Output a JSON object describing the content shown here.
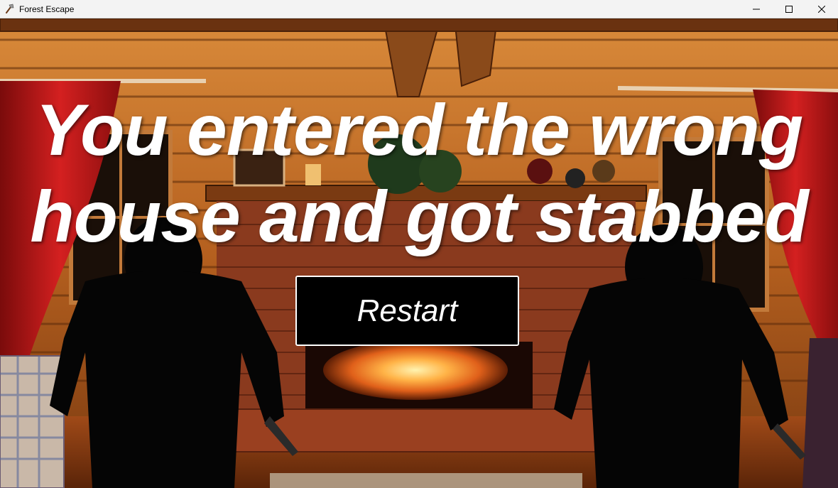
{
  "window": {
    "title": "Forest Escape",
    "controls": [
      "minimize-icon",
      "maximize-icon",
      "close-icon"
    ]
  },
  "game": {
    "message_line1": "You entered the wrong",
    "message_line2": "house and got stabbed",
    "restart_label": "Restart",
    "scene": "log-cabin-living-room-with-fireplace-and-two-silhouetted-figures"
  },
  "colors": {
    "titlebar_bg": "#f3f3f3",
    "message_text": "#ffffff",
    "button_bg": "#000000",
    "button_border": "#ffffff"
  }
}
